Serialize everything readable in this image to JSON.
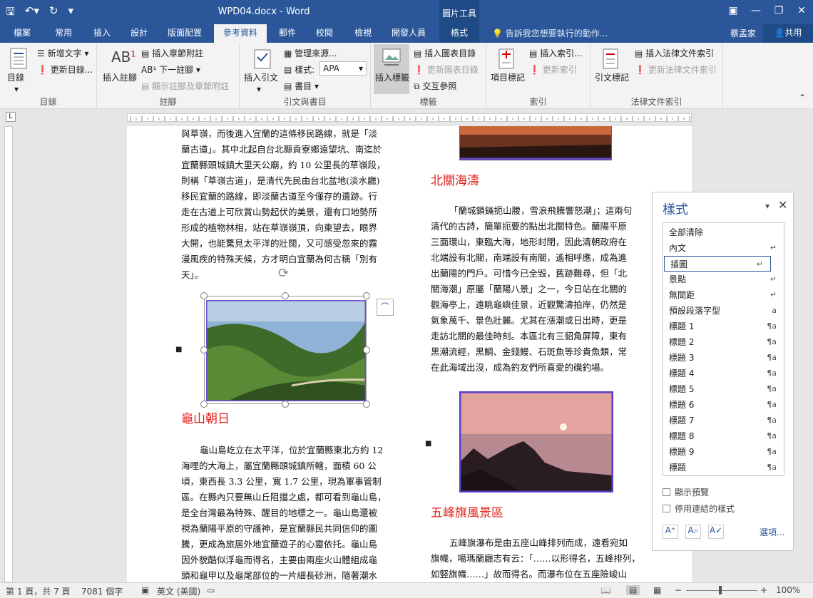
{
  "title_bar": {
    "doc_title": "WPD04.docx - Word",
    "contextual_group": "圖片工具",
    "qat": [
      "save-icon",
      "undo-icon",
      "redo-icon",
      "customize-icon"
    ]
  },
  "tabs": [
    "檔案",
    "常用",
    "插入",
    "設計",
    "版面配置",
    "參考資料",
    "郵件",
    "校閱",
    "檢視",
    "開發人員",
    "格式"
  ],
  "active_tab": "參考資料",
  "tell_me": "告訴我您想要執行的動作...",
  "user": "蔡孟家",
  "share": "共用",
  "ribbon": {
    "toc": {
      "big": "目錄",
      "add_text": "新增文字",
      "update": "更新目錄...",
      "label": "目錄"
    },
    "footnotes": {
      "big": "插入註腳",
      "insert_endnote": "插入章節附註",
      "next": "下一註腳",
      "show": "顯示註腳及章節附註",
      "label": "註腳"
    },
    "citations": {
      "big": "插入引文",
      "manage": "管理來源...",
      "style_label": "樣式:",
      "style_value": "APA",
      "bibliography": "書目",
      "label": "引文與書目"
    },
    "captions": {
      "big": "插入標籤",
      "insert_table": "插入圖表目錄",
      "update_table": "更新圖表目錄",
      "cross_ref": "交互參照",
      "label": "標籤"
    },
    "index": {
      "big": "項目標記",
      "insert": "插入索引...",
      "update": "更新索引",
      "label": "索引"
    },
    "authorities": {
      "big": "引文標記",
      "insert": "插入法律文件索引",
      "update": "更新法律文件索引",
      "label": "法律文件索引"
    }
  },
  "document": {
    "left_top_lines": [
      "與草嶺，而後進入宜蘭的這條移民路線，就是「淡",
      "蘭古道」。其中北起自台北縣貢寮鄉遠望坑、南迄於",
      "宜蘭縣頭城鎮大里天公廟，約 10 公里長的草嶺段，",
      "則稱「草嶺古道」，是清代先民由台北盆地(淡水廳)",
      "移民宜蘭的路線，即淡蘭古道至今僅存的遺跡。行",
      "走在古道上可欣賞山勢起伏的美景，還有口地勢所",
      "形成的植物林相，站在草嶺嶺頂，向東望去，眼界",
      "大開，也能驚見太平洋的壯闊，又可感受忽來的霧",
      "漫風疾的特殊天候，方才明白宜蘭為何古稱「別有",
      "天」。"
    ],
    "heading_left": "龜山朝日",
    "left_bottom_lines": [
      "龜山島屹立在太平洋，位於宜蘭縣東北方約 12",
      "海哩的大海上，屬宜蘭縣頭城鎮所轄，面積 60 公",
      "頃，東西長 3.3 公里，寬 1.7 公里，現為軍事管制",
      "區。在縣內只要無山丘阻擋之處，都可看到龜山島，",
      "是全台灣最為特殊、醒目的地標之一。龜山島還被",
      "視為蘭陽平原的守護神，是宜蘭縣民共同信仰的圖",
      "騰，更成為旅居外地宜蘭遊子的心靈依托。龜山島",
      "因外貌酷似浮龜而得名，主要由兩座火山體組成龜",
      "頭和龜甲以及龜尾部位的一片細長砂洲，隨著潮水"
    ],
    "heading_right1": "北關海濤",
    "right_lines": [
      "「蘭城鎖鑰扼山腰，雪浪飛騰響怒潮」；這兩句",
      "清代的古詩，簡單扼要的點出北關特色。蘭陽平原",
      "三面環山，東臨大海，地形封閉，因此清朝政府在",
      "北端設有北關，南端設有南關，遙相呼應，成為進",
      "出蘭陽的門戶。可惜今已全毀，舊跡難尋，但「北",
      "關海潮」原屬「蘭陽八景」之一，今日站在北關的",
      "觀海亭上，遠眺龜嶼佳景，近觀驚濤拍岸，仍然是",
      "氣象萬千、景色壯麗。尤其在漲潮或日出時，更是",
      "走訪北關的最佳時刻。本區北有三貂角屏障，東有",
      "黑潮流經，黑鯛、金錢鰻、石斑魚等珍貴魚類，常",
      "在此海域出沒，成為釣友們所喜愛的磯釣場。"
    ],
    "heading_right2": "五峰旗風景區",
    "right_bottom_lines": [
      "五峰旗瀑布是由五座山峰排列而成，遠看宛如",
      "旗幟，噶瑪蘭廳志有云：「……以形得名，五峰排列，",
      "如竪旗幟……」故而得名。而瀑布位在五座險峻山"
    ]
  },
  "styles_pane": {
    "title": "樣式",
    "items": [
      {
        "name": "全部清除",
        "mark": ""
      },
      {
        "name": "內文",
        "mark": "↵"
      },
      {
        "name": "插圖",
        "mark": "↵"
      },
      {
        "name": "景點",
        "mark": "↵"
      },
      {
        "name": "無間距",
        "mark": "↵"
      },
      {
        "name": "預設段落字型",
        "mark": "a"
      },
      {
        "name": "標題 1",
        "mark": "¶a"
      },
      {
        "name": "標題 2",
        "mark": "¶a"
      },
      {
        "name": "標題 3",
        "mark": "¶a"
      },
      {
        "name": "標題 4",
        "mark": "¶a"
      },
      {
        "name": "標題 5",
        "mark": "¶a"
      },
      {
        "name": "標題 6",
        "mark": "¶a"
      },
      {
        "name": "標題 7",
        "mark": "¶a"
      },
      {
        "name": "標題 8",
        "mark": "¶a"
      },
      {
        "name": "標題 9",
        "mark": "¶a"
      },
      {
        "name": "標題",
        "mark": "¶a"
      }
    ],
    "selected": "插圖",
    "show_preview": "顯示預覽",
    "disable_linked": "停用連結的樣式",
    "options": "選項..."
  },
  "status": {
    "page": "第 1 頁，共 7 頁",
    "words": "7081 個字",
    "lang": "英文 (美國)",
    "zoom": "100%"
  }
}
